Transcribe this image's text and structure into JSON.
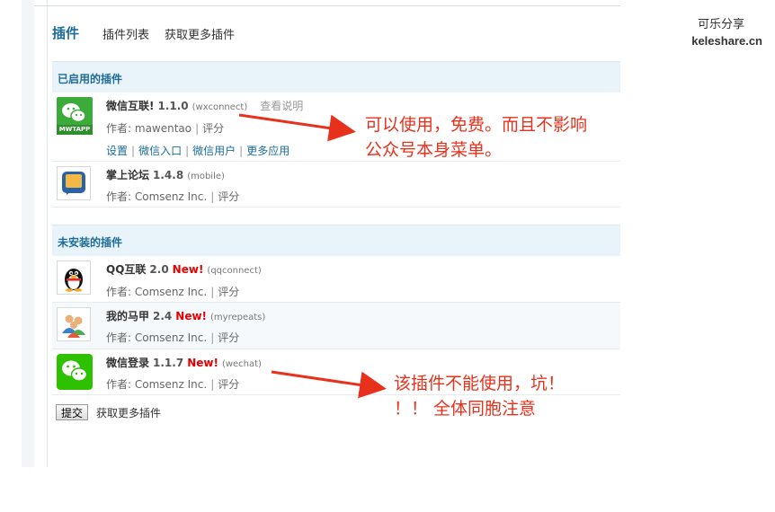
{
  "nav": {
    "active": "插件",
    "tabs": [
      "插件列表",
      "获取更多插件"
    ]
  },
  "enabled": {
    "title": "已启用的插件",
    "plugins": [
      {
        "name": "微信互联!",
        "version": "1.1.0",
        "id": "(wxconnect)",
        "desc": "查看说明",
        "author_label": "作者:",
        "author": "mawentao",
        "rate": "评分",
        "links": [
          "设置",
          "微信入口",
          "微信用户",
          "更多应用"
        ],
        "icon": "mwtapp-wechat-icon",
        "icon_text": "MWTAPP"
      },
      {
        "name": "掌上论坛",
        "version": "1.4.8",
        "id": "(mobile)",
        "author_label": "作者:",
        "author": "Comsenz Inc.",
        "rate": "评分",
        "icon": "mobile-forum-icon"
      }
    ]
  },
  "uninstalled": {
    "title": "未安装的插件",
    "plugins": [
      {
        "name": "QQ互联",
        "version": "2.0",
        "new": "New!",
        "id": "(qqconnect)",
        "author_label": "作者:",
        "author": "Comsenz Inc.",
        "rate": "评分",
        "icon": "qq-penguin-icon"
      },
      {
        "name": "我的马甲",
        "version": "2.4",
        "new": "New!",
        "id": "(myrepeats)",
        "author_label": "作者:",
        "author": "Comsenz Inc.",
        "rate": "评分",
        "icon": "users-icon"
      },
      {
        "name": "微信登录",
        "version": "1.1.7",
        "new": "New!",
        "id": "(wechat)",
        "author_label": "作者:",
        "author": "Comsenz Inc.",
        "rate": "评分",
        "icon": "wechat-icon"
      }
    ]
  },
  "footer": {
    "submit": "提交",
    "more": "获取更多插件"
  },
  "annotations": {
    "top": [
      "可以使用，免费。而且不影响",
      "公众号本身菜单。"
    ],
    "bottom": [
      "该插件不能使用，坑！",
      "！！ 全体同胞注意"
    ]
  },
  "watermark": {
    "line1": "可乐分享",
    "line2": "keleshare.cn"
  },
  "colors": {
    "accent": "#1c6c97",
    "new": "#e60000",
    "annotation": "#e8311c",
    "wechat_green": "#2dc100"
  }
}
